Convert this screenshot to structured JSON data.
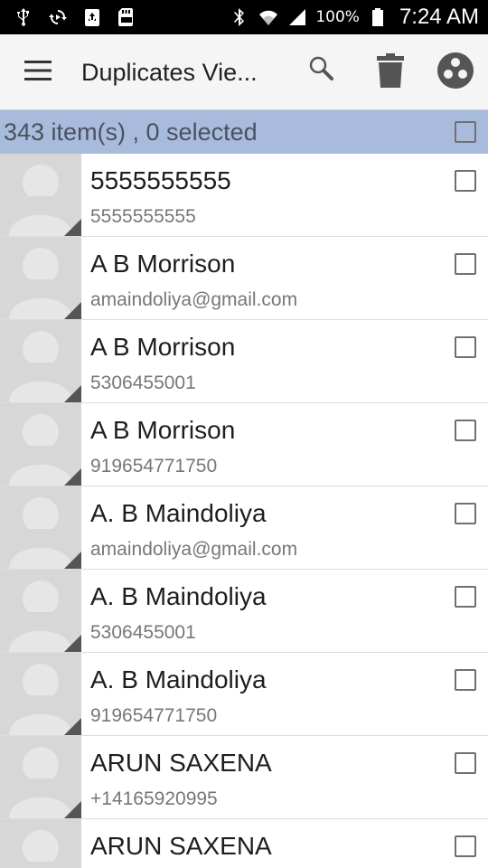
{
  "status_bar": {
    "left_icons": [
      "usb-icon",
      "sync-icon",
      "recycle-icon",
      "sd-card-icon"
    ],
    "right_icons": [
      "bluetooth-icon",
      "wifi-icon",
      "signal-icon",
      "battery-icon"
    ],
    "battery_percent": "100%",
    "time": "7:24 AM"
  },
  "action_bar": {
    "title": "Duplicates Vie...",
    "menu_icon": "hamburger-menu-icon",
    "actions": [
      "search-icon",
      "trash-icon",
      "merge-icon"
    ]
  },
  "summary": {
    "text": "343 item(s) , 0 selected",
    "select_all_checked": false
  },
  "contacts": [
    {
      "name": "5555555555",
      "detail": "5555555555",
      "checked": false
    },
    {
      "name": "A B Morrison",
      "detail": "amaindoliya@gmail.com",
      "checked": false
    },
    {
      "name": "A B Morrison",
      "detail": "5306455001",
      "checked": false
    },
    {
      "name": "A B Morrison",
      "detail": "919654771750",
      "checked": false
    },
    {
      "name": "A. B Maindoliya",
      "detail": "amaindoliya@gmail.com",
      "checked": false
    },
    {
      "name": "A. B Maindoliya",
      "detail": "5306455001",
      "checked": false
    },
    {
      "name": "A. B Maindoliya",
      "detail": "919654771750",
      "checked": false
    },
    {
      "name": "ARUN SAXENA",
      "detail": "+14165920995",
      "checked": false
    },
    {
      "name": "ARUN SAXENA",
      "detail": "",
      "checked": false
    }
  ],
  "colors": {
    "summary_bar": "#a9bbdd",
    "action_bar": "#f5f5f5",
    "status_bar": "#000000",
    "avatar_bg": "#d7d7d7"
  }
}
